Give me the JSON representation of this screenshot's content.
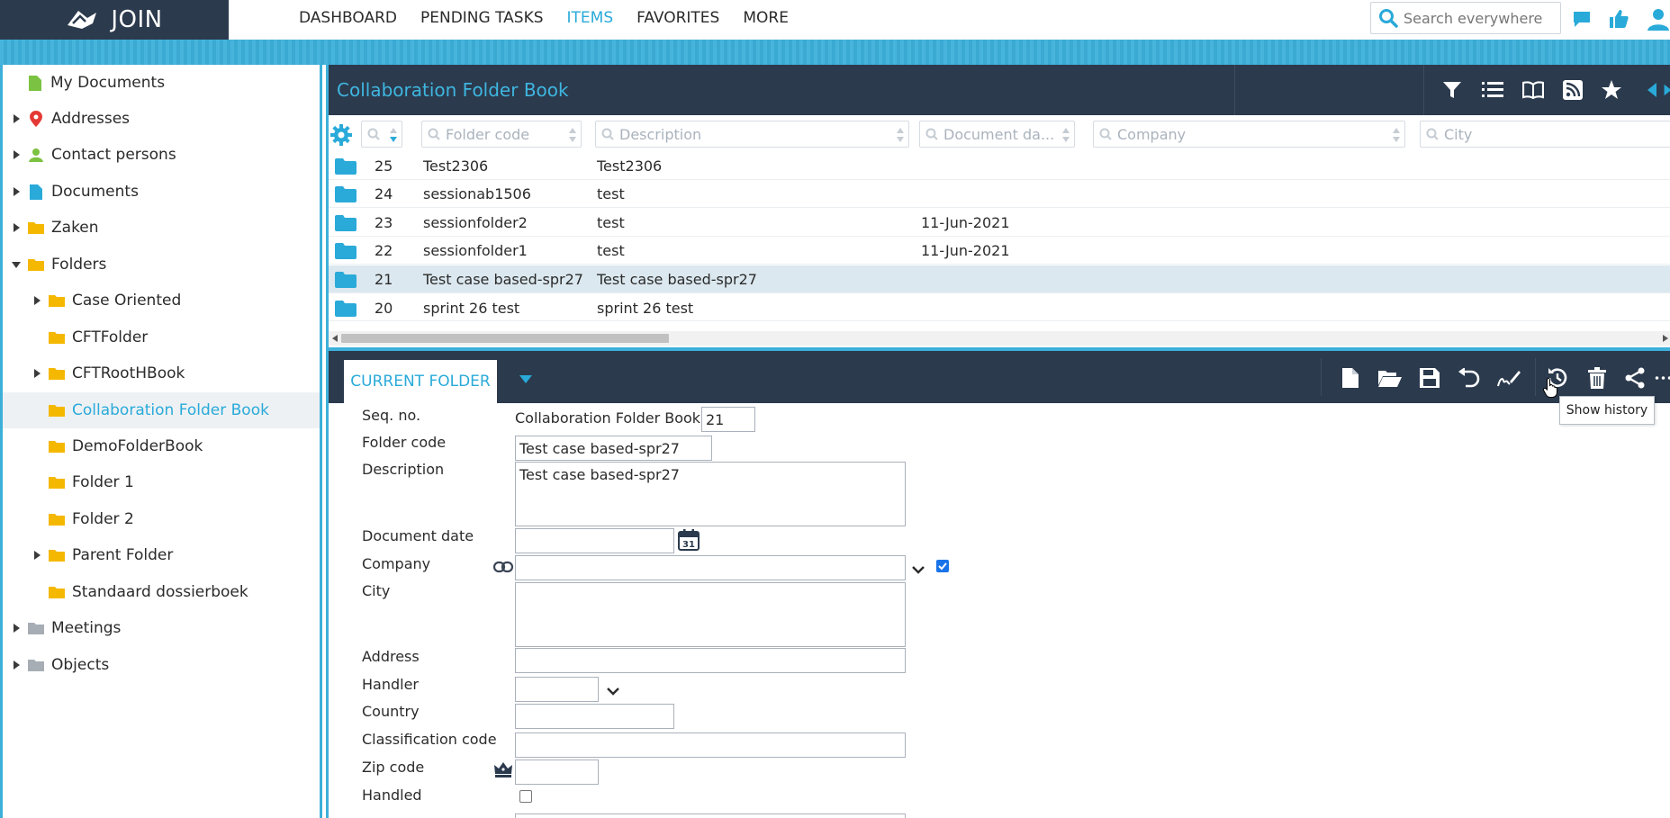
{
  "app": {
    "logo_text": "JOIN"
  },
  "nav": {
    "items": [
      {
        "label": "DASHBOARD",
        "active": false
      },
      {
        "label": "PENDING TASKS",
        "active": false
      },
      {
        "label": "ITEMS",
        "active": true
      },
      {
        "label": "FAVORITES",
        "active": false
      },
      {
        "label": "MORE",
        "active": false
      }
    ]
  },
  "search": {
    "placeholder": "Search everywhere"
  },
  "sidebar": {
    "items": [
      {
        "label": "My Documents",
        "icon": "document-green-icon",
        "expandable": false,
        "expanded": false,
        "level": 0
      },
      {
        "label": "Addresses",
        "icon": "map-pin-icon",
        "expandable": true,
        "expanded": false,
        "level": 0
      },
      {
        "label": "Contact persons",
        "icon": "person-icon",
        "expandable": true,
        "expanded": false,
        "level": 0
      },
      {
        "label": "Documents",
        "icon": "document-blue-icon",
        "expandable": true,
        "expanded": false,
        "level": 0
      },
      {
        "label": "Zaken",
        "icon": "folder-icon",
        "expandable": true,
        "expanded": false,
        "level": 0
      },
      {
        "label": "Folders",
        "icon": "folder-icon",
        "expandable": true,
        "expanded": true,
        "level": 0
      },
      {
        "label": "Case Oriented",
        "icon": "folder-icon",
        "expandable": true,
        "expanded": false,
        "level": 1
      },
      {
        "label": "CFTFolder",
        "icon": "folder-icon",
        "expandable": false,
        "expanded": false,
        "level": 1
      },
      {
        "label": "CFTRootHBook",
        "icon": "folder-icon",
        "expandable": true,
        "expanded": false,
        "level": 1
      },
      {
        "label": "Collaboration Folder Book",
        "icon": "folder-icon",
        "expandable": false,
        "expanded": false,
        "level": 1,
        "selected": true
      },
      {
        "label": "DemoFolderBook",
        "icon": "folder-icon",
        "expandable": false,
        "expanded": false,
        "level": 1
      },
      {
        "label": "Folder 1",
        "icon": "folder-icon",
        "expandable": false,
        "expanded": false,
        "level": 1
      },
      {
        "label": "Folder 2",
        "icon": "folder-icon",
        "expandable": false,
        "expanded": false,
        "level": 1
      },
      {
        "label": "Parent Folder",
        "icon": "folder-icon",
        "expandable": true,
        "expanded": false,
        "level": 1
      },
      {
        "label": "Standaard dossierboek",
        "icon": "folder-icon",
        "expandable": false,
        "expanded": false,
        "level": 1
      },
      {
        "label": "Meetings",
        "icon": "folder-grey-icon",
        "expandable": true,
        "expanded": false,
        "level": 0
      },
      {
        "label": "Objects",
        "icon": "folder-grey-icon",
        "expandable": true,
        "expanded": false,
        "level": 0
      }
    ]
  },
  "list": {
    "title": "Collaboration Folder Book",
    "filters": {
      "folder_code": "Folder code",
      "description": "Description",
      "document_date": "Document da...",
      "company": "Company",
      "city": "City"
    },
    "rows": [
      {
        "seq": "25",
        "code": "Test2306",
        "description": "Test2306",
        "date": "",
        "selected": false
      },
      {
        "seq": "24",
        "code": "sessionab1506",
        "description": "test",
        "date": "",
        "selected": false
      },
      {
        "seq": "23",
        "code": "sessionfolder2",
        "description": "test",
        "date": "11-Jun-2021",
        "selected": false
      },
      {
        "seq": "22",
        "code": "sessionfolder1",
        "description": "test",
        "date": "11-Jun-2021",
        "selected": false
      },
      {
        "seq": "21",
        "code": "Test case based-spr27",
        "description": "Test case based-spr27",
        "date": "",
        "selected": true
      },
      {
        "seq": "20",
        "code": "sprint 26 test",
        "description": "sprint 26 test",
        "date": "",
        "selected": false
      }
    ]
  },
  "detail": {
    "tab_label": "CURRENT FOLDER",
    "tooltip": "Show history",
    "labels": {
      "seq_no": "Seq. no.",
      "folder_code": "Folder code",
      "description": "Description",
      "document_date": "Document date",
      "company": "Company",
      "city": "City",
      "address": "Address",
      "handler": "Handler",
      "country": "Country",
      "classification_code": "Classification code",
      "zip_code": "Zip code",
      "handled": "Handled"
    },
    "values": {
      "seq_prefix": "Collaboration Folder Book -",
      "seq_no": "21",
      "folder_code": "Test case based-spr27",
      "description": "Test case based-spr27",
      "document_date": "",
      "company": "",
      "company_checked": true,
      "city": "",
      "address": "",
      "handler": "",
      "country": "",
      "classification_code": "",
      "zip_code": "",
      "handled": false
    },
    "calendar_day": "31"
  },
  "colors": {
    "brand_dark": "#2b3a4d",
    "accent": "#29aad9",
    "stripe": "#3db0da",
    "folder_yellow": "#f5b800",
    "folder_blue": "#29aad9"
  }
}
